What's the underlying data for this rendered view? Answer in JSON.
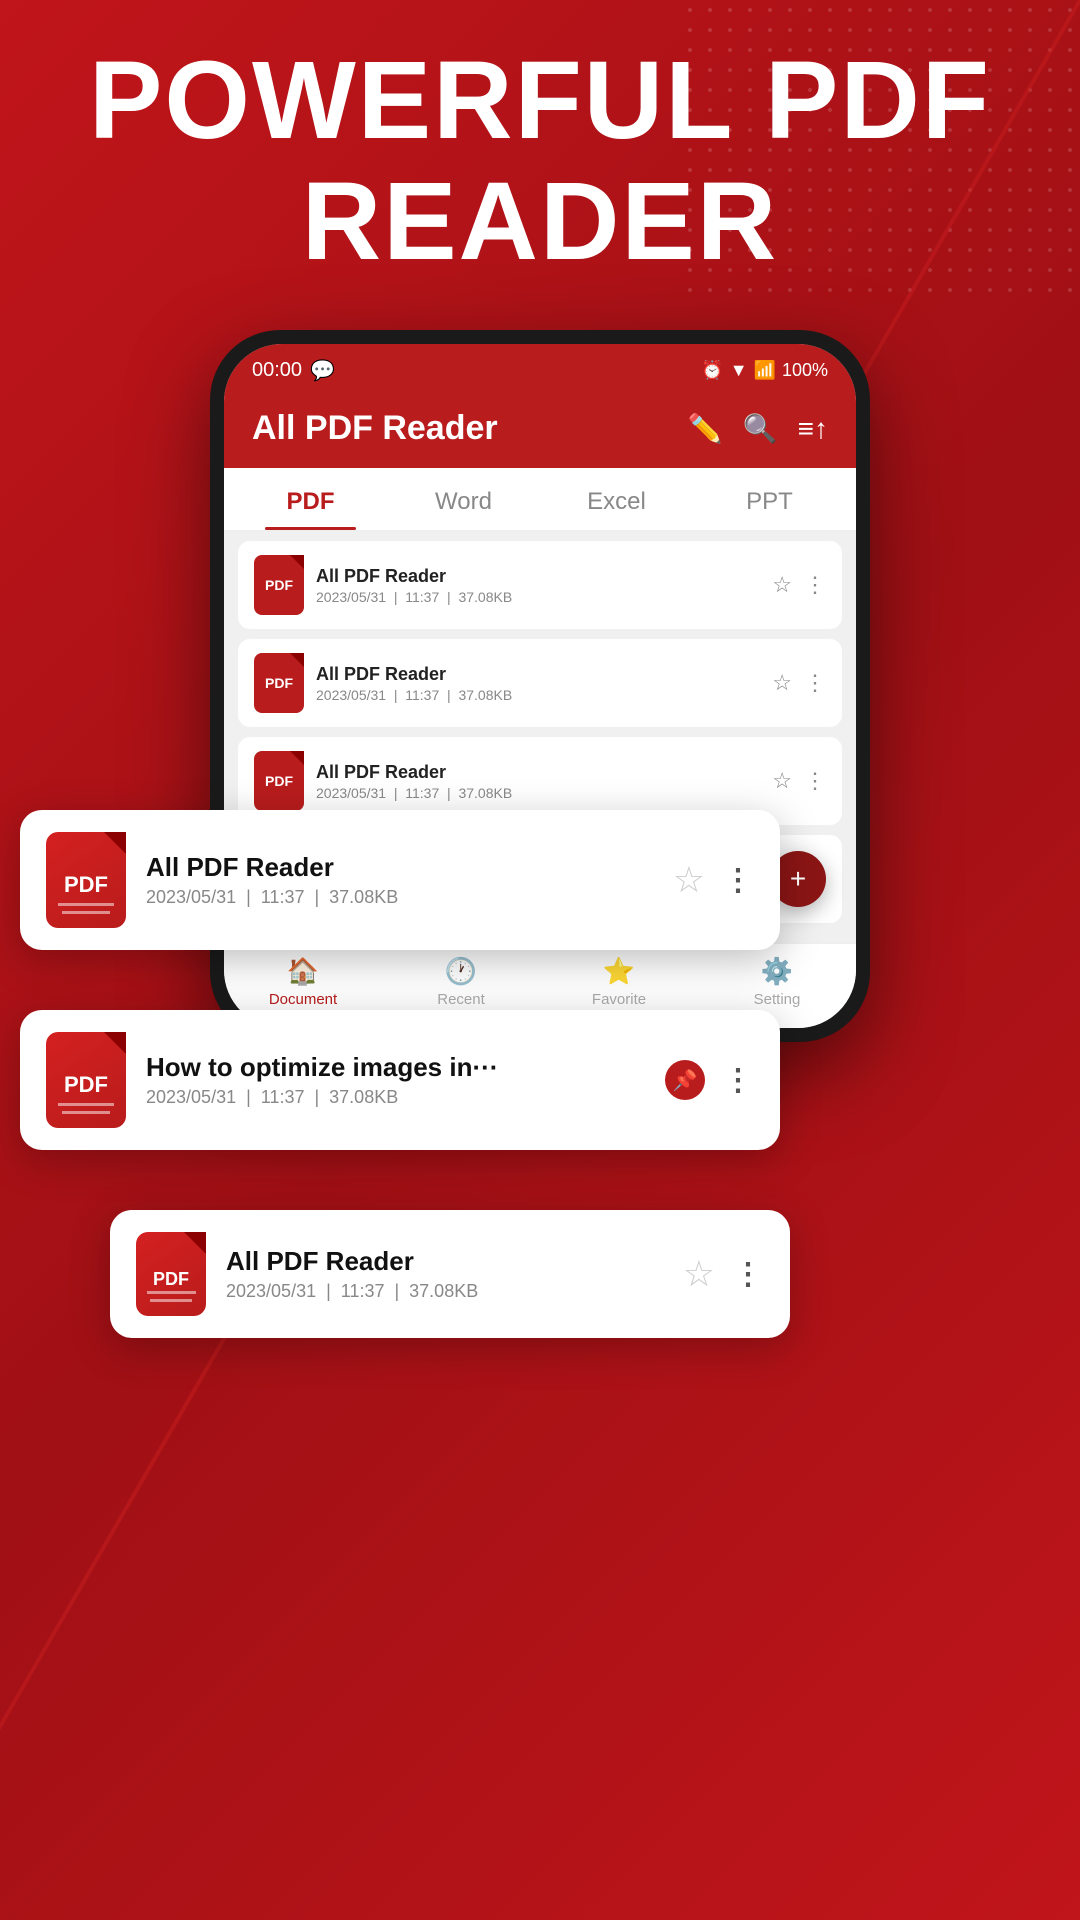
{
  "hero": {
    "title_line1": "POWERFUL PDF",
    "title_line2": "READER"
  },
  "status_bar": {
    "time": "00:00",
    "battery": "100%"
  },
  "app_bar": {
    "title": "All PDF Reader"
  },
  "tabs": [
    {
      "id": "pdf",
      "label": "PDF",
      "active": true
    },
    {
      "id": "word",
      "label": "Word",
      "active": false
    },
    {
      "id": "excel",
      "label": "Excel",
      "active": false
    },
    {
      "id": "ppt",
      "label": "PPT",
      "active": false
    }
  ],
  "files": [
    {
      "name": "All PDF Reader",
      "date": "2023/05/31",
      "time": "11:37",
      "size": "37.08KB",
      "starred": false,
      "pinned": false
    },
    {
      "name": "How to optimize images in···",
      "date": "2023/05/31",
      "time": "11:37",
      "size": "37.08KB",
      "starred": false,
      "pinned": true
    },
    {
      "name": "All PDF Reader",
      "date": "2023/05/31",
      "time": "11:37",
      "size": "37.08KB",
      "starred": false,
      "pinned": false
    },
    {
      "name": "All PDF Reader",
      "date": "2023/05/31",
      "time": "11:37",
      "size": "37.08KB",
      "starred": false,
      "pinned": false
    },
    {
      "name": "All PDF Reader",
      "date": "2023/05/31",
      "time": "11:37",
      "size": "37.08KB",
      "starred": false,
      "pinned": false
    },
    {
      "name": "All PDF Reader",
      "date": "2023/05/31",
      "time": "11:37",
      "size": "37.08KB",
      "starred": false,
      "pinned": false
    }
  ],
  "float_cards": [
    {
      "id": "card1",
      "name": "All PDF Reader",
      "date": "2023/05/31",
      "time": "11:37",
      "size": "37.08KB",
      "starred": false,
      "pinned": false
    },
    {
      "id": "card2",
      "name": "How to optimize images in···",
      "date": "2023/05/31",
      "time": "11:37",
      "size": "37.08KB",
      "starred": false,
      "pinned": true
    },
    {
      "id": "card3",
      "name": "All PDF Reader",
      "date": "2023/05/31",
      "time": "11:37",
      "size": "37.08KB",
      "starred": false,
      "pinned": false
    }
  ],
  "bottom_nav": [
    {
      "id": "document",
      "label": "Document",
      "active": true
    },
    {
      "id": "recent",
      "label": "Recent",
      "active": false
    },
    {
      "id": "favorite",
      "label": "Favorite",
      "active": false
    },
    {
      "id": "setting",
      "label": "Setting",
      "active": false
    }
  ],
  "fab": {
    "label": "+"
  }
}
